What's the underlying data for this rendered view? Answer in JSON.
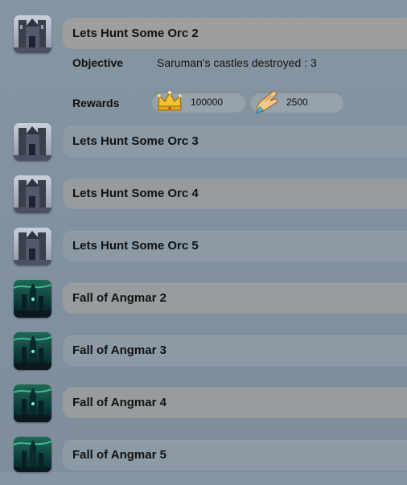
{
  "quests": [
    {
      "title": "Lets Hunt Some Orc 2",
      "thumb": "castle-thumbnail",
      "selected": true
    },
    {
      "title": "Lets Hunt Some Orc 3",
      "thumb": "castle-thumbnail",
      "selected": false
    },
    {
      "title": "Lets Hunt Some Orc 4",
      "thumb": "castle-thumbnail",
      "selected": false
    },
    {
      "title": "Lets Hunt Some Orc 5",
      "thumb": "castle-thumbnail",
      "selected": false
    },
    {
      "title": "Fall of Angmar 2",
      "thumb": "angmar-thumbnail",
      "selected": false
    },
    {
      "title": "Fall of Angmar 3",
      "thumb": "angmar-thumbnail",
      "selected": false
    },
    {
      "title": "Fall of Angmar 4",
      "thumb": "angmar-thumbnail",
      "selected": false
    },
    {
      "title": "Fall of Angmar 5",
      "thumb": "angmar-thumbnail",
      "selected": false
    }
  ],
  "details": {
    "objective_label": "Objective",
    "objective_value": "Saruman's castles destroyed : 3",
    "rewards_label": "Rewards",
    "rewards": [
      {
        "icon": "crown-icon",
        "value": "100000"
      },
      {
        "icon": "hand-icon",
        "value": "2500"
      }
    ]
  },
  "colors": {
    "background": "#8494a1",
    "selected_bar": "#9e9f9c",
    "normal_bar": "#8c9aa6",
    "text": "#111111"
  }
}
